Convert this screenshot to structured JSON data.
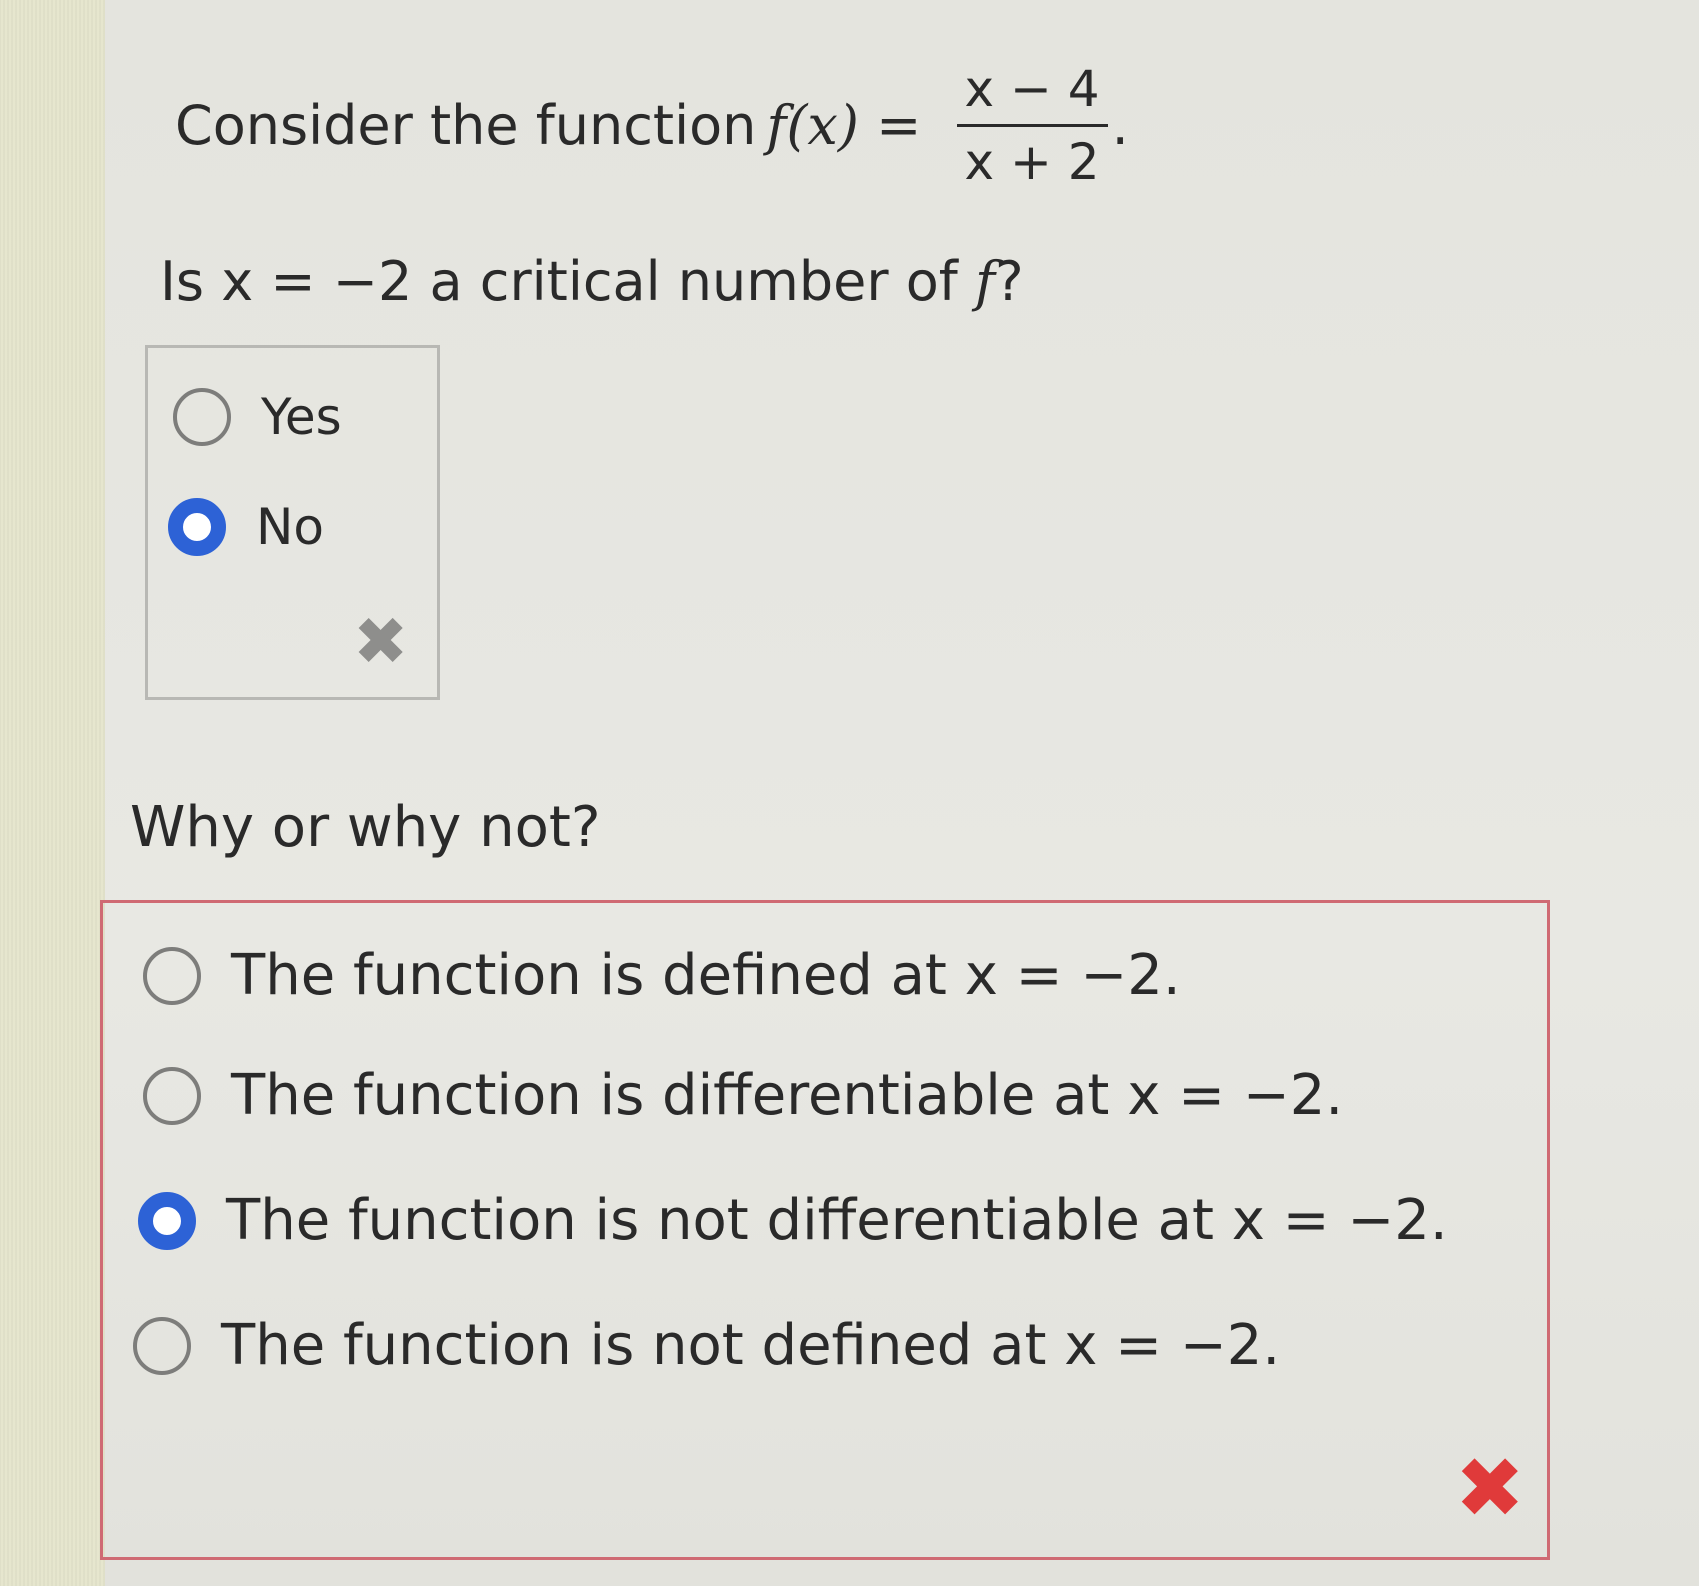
{
  "question": {
    "prefix": "Consider the function ",
    "func": "f(x)",
    "equals": " = ",
    "numerator": "x − 4",
    "denominator": "x + 2",
    "period": "."
  },
  "part1": {
    "prompt_prefix": "Is x = −2 a critical number of ",
    "prompt_var": "f",
    "prompt_suffix": "?",
    "options": [
      {
        "label": "Yes",
        "selected": false
      },
      {
        "label": "No",
        "selected": true
      }
    ],
    "feedback_icon": "x-mark-icon",
    "feedback_color": "#8e8e8c"
  },
  "part2": {
    "prompt": "Why or why not?",
    "options": [
      {
        "label": "The function is defined at x = −2.",
        "selected": false
      },
      {
        "label": "The function is differentiable at x = −2.",
        "selected": false
      },
      {
        "label": "The function is not differentiable at x = −2.",
        "selected": true
      },
      {
        "label": "The function is not defined at x = −2.",
        "selected": false
      }
    ],
    "feedback_icon": "x-mark-icon",
    "feedback_color": "#e03a3a",
    "border_color": "#cf6a73"
  },
  "colors": {
    "radio_selected": "#2d62d6",
    "radio_unselected": "#7d7d7b"
  }
}
